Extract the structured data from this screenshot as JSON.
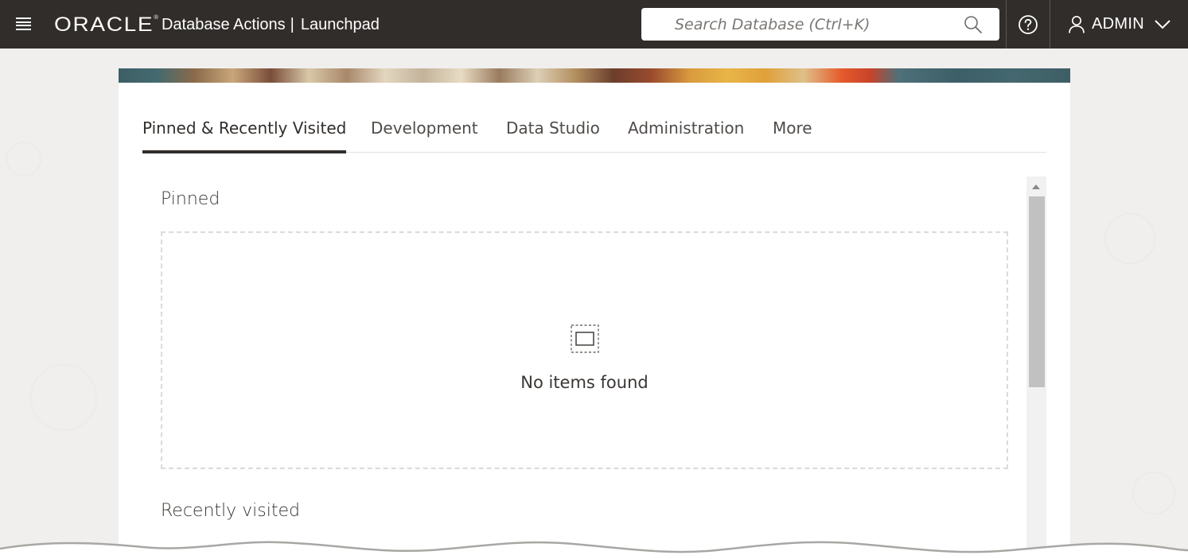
{
  "header": {
    "menu_icon": "hamburger-icon",
    "logo_text": "ORACLE",
    "logo_mark": "®",
    "app_name": "Database Actions",
    "separator": "|",
    "page_name": "Launchpad",
    "search": {
      "placeholder": "Search Database (Ctrl+K)",
      "value": "",
      "icon": "search-icon"
    },
    "help_icon": "help-circle-icon",
    "user": {
      "icon": "user-icon",
      "name": "ADMIN",
      "dropdown_icon": "chevron-down-icon"
    },
    "colors": {
      "bar": "#312d2a",
      "text": "#ffffff"
    }
  },
  "tabs": [
    {
      "label": "Pinned & Recently Visited",
      "active": true
    },
    {
      "label": "Development",
      "active": false
    },
    {
      "label": "Data Studio",
      "active": false
    },
    {
      "label": "Administration",
      "active": false
    },
    {
      "label": "More",
      "active": false
    }
  ],
  "pinned": {
    "title": "Pinned",
    "empty_icon": "empty-box-icon",
    "empty_text": "No items found"
  },
  "recent": {
    "title": "Recently visited"
  },
  "scrollbar": {
    "up_icon": "scroll-up-arrow-icon"
  }
}
